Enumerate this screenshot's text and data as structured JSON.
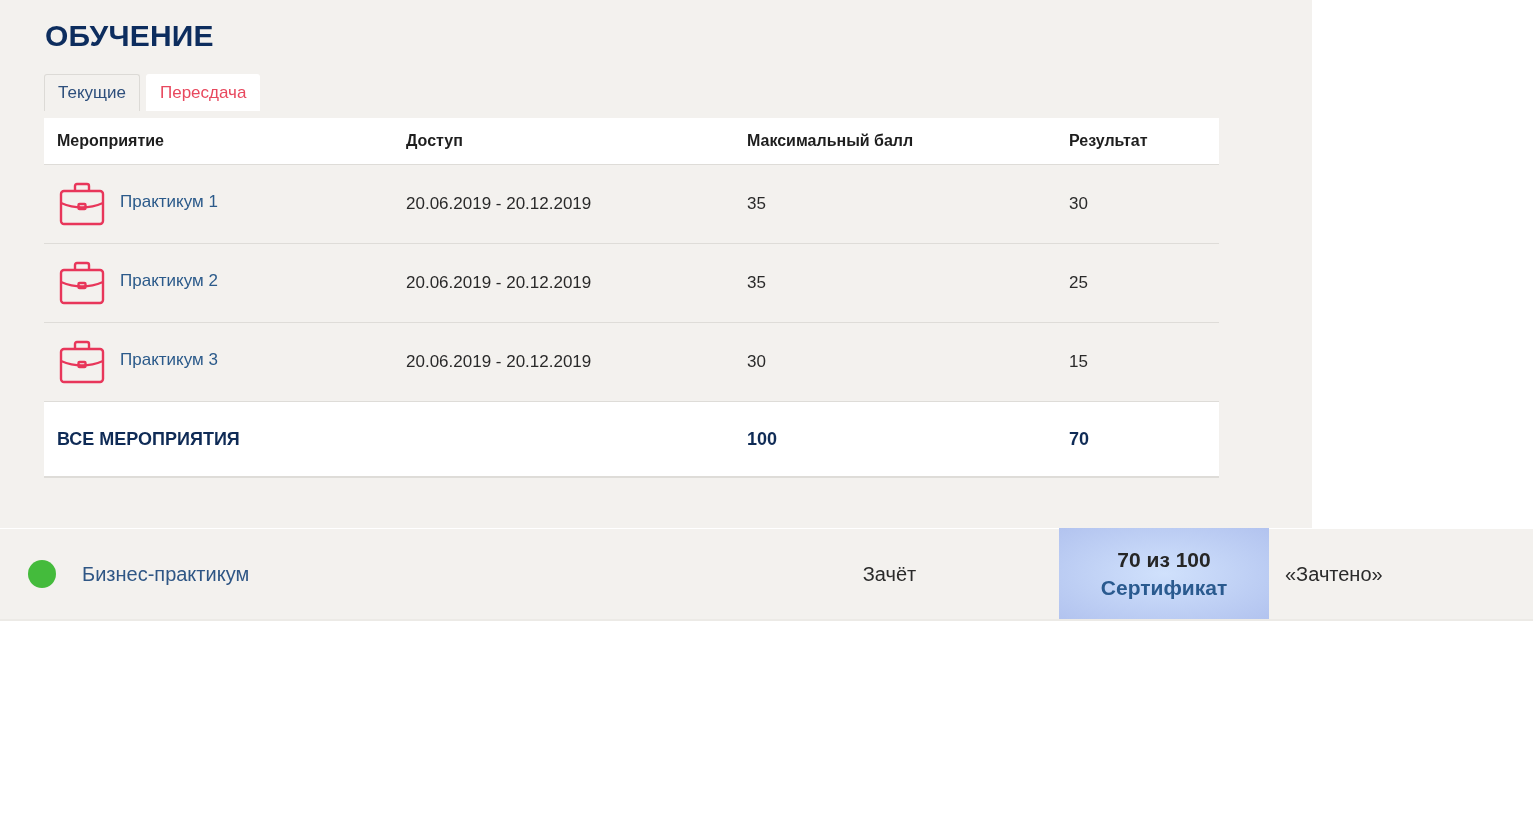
{
  "page": {
    "title": "ОБУЧЕНИЕ"
  },
  "tabs": [
    {
      "label": "Текущие",
      "selected": true
    },
    {
      "label": "Пересдача",
      "selected": false
    }
  ],
  "table": {
    "columns": [
      "Мероприятие",
      "Доступ",
      "Максимальный балл",
      "Результат"
    ],
    "rows": [
      {
        "event": "Практикум 1",
        "access": "20.06.2019 - 20.12.2019",
        "max_score": "35",
        "result": "30"
      },
      {
        "event": "Практикум 2",
        "access": "20.06.2019 - 20.12.2019",
        "max_score": "35",
        "result": "25"
      },
      {
        "event": "Практикум 3",
        "access": "20.06.2019 - 20.12.2019",
        "max_score": "30",
        "result": "15"
      }
    ],
    "total": {
      "label": "ВСЕ МЕРОПРИЯТИЯ",
      "max_score": "100",
      "result": "70"
    }
  },
  "courses": [
    {
      "color": "#44bb3c",
      "name": "Бизнес-практикум",
      "assessment": "Зачёт",
      "score": "70 из 100",
      "certificate": "Сертификат",
      "grade": "«Зачтено»"
    }
  ]
}
